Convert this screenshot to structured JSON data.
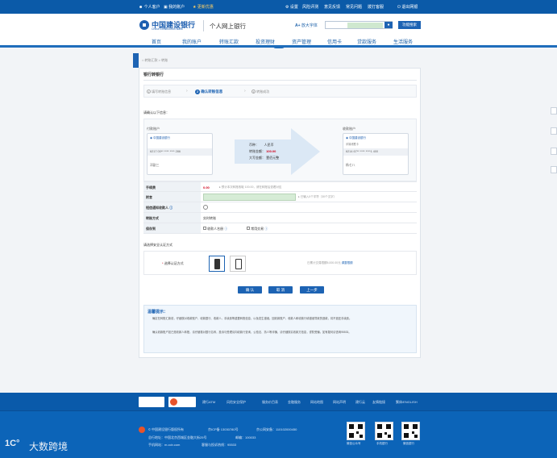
{
  "topbar": {
    "personal": "个人客户",
    "my_account": "我的账户",
    "promo": "更新优惠",
    "settings": "设置",
    "risk": "风险评测",
    "feedback": "意见反馈",
    "common": "常见问题",
    "foreign": "拨打客服",
    "logout": "退出网银"
  },
  "header": {
    "logo_cn": "中国建设银行",
    "logo_en": "China Construction Bank",
    "title": "个人网上银行",
    "font_large": "放大字体",
    "search_btn": "功能搜索"
  },
  "nav": {
    "items": [
      "首页",
      "我的账户",
      "转账汇款",
      "投资理财",
      "资产管理",
      "信用卡",
      "贷款服务",
      "生活服务"
    ]
  },
  "breadcrumb": "转账汇款 > 转账",
  "panel_title": "银行转银行",
  "steps": [
    {
      "num": "1",
      "label": "填写转账信息"
    },
    {
      "num": "2",
      "label": "确认转账信息"
    },
    {
      "num": "3",
      "label": "转账成功"
    }
  ],
  "confirm_prompt": "请确认以下信息：",
  "payer": {
    "heading": "付款账户",
    "bank": "中国建设银行",
    "account": "6217 00** **** **** 286",
    "name": "邓副三"
  },
  "payee": {
    "heading": "收款账户",
    "bank": "中国建设银行",
    "bank_sub": "邓娟储蓄卡",
    "account": "6214 67** **** ****1 400",
    "name": "杨七八"
  },
  "transfer": {
    "currency_label": "币种：",
    "currency": "人民币",
    "amount_label": "转账金额：",
    "amount": "100.00",
    "upper_label": "大写金额：",
    "upper": "壹佰元整"
  },
  "fields": {
    "fee_label": "手续费",
    "fee_value": "0.00",
    "fee_note": "预计本次转账收取 100.00，请在转账后查看对应",
    "remark_label": "附言",
    "remark_note": "已输入0个字符（30个汉字）",
    "sms_label": "短信通知收款人",
    "method_label": "转账方式",
    "method_value": "实时转账",
    "save_label": "保存到",
    "save_opt1": "收款人名册",
    "save_opt2": "常用交易"
  },
  "security": {
    "heading": "请选择安全认证方式",
    "label": "选择认证方式",
    "note": "日累计交易限额5,000.00元",
    "link": "调整限额"
  },
  "buttons": {
    "confirm": "确 认",
    "cancel": "取 消",
    "prev": "上一步"
  },
  "tips": {
    "title": "温馨提示：",
    "line1": "确定在转账汇款前，仔细核对收款账户、收款银行、收款人、手续费等重要转账信息，以免发生错误。因收款账户、收款人和收款行填错误导致的退款，将不退还手续费。",
    "line2": "确认收款账户如已是收款人转账，请仔细核对银行名称，投诉与受理请向收款行查询，公检法、熟人等诈骗，请仔细核实收款方信息，谨防受骗。如有疑问请咨询95533。"
  },
  "footer": {
    "links": [
      "建行ATM",
      "风险安全保护",
      "服务价目表",
      "金融服务",
      "网站地图",
      "网站声明",
      "建行云",
      "友情链接",
      "繁体/ENGLISH"
    ],
    "copyright": "© 中国建设银行版权所有",
    "icp": "京ICP备 13030780号",
    "security_no": "京公网安备：110102000450",
    "address": "总行地址：中国北京西城区金融大街25号",
    "postcode": "邮编：100033",
    "site": "手机网站：m.ccb.com",
    "hotline": "客服与投诉热线：95533",
    "qr1": "微信公众号",
    "qr2": "手机银行",
    "qr3": "微信银行"
  },
  "watermark": "大数跨境",
  "colors": {
    "brand": "#0b5aa8",
    "accent_red": "#d0021b",
    "step_active": "#1d63b3"
  }
}
